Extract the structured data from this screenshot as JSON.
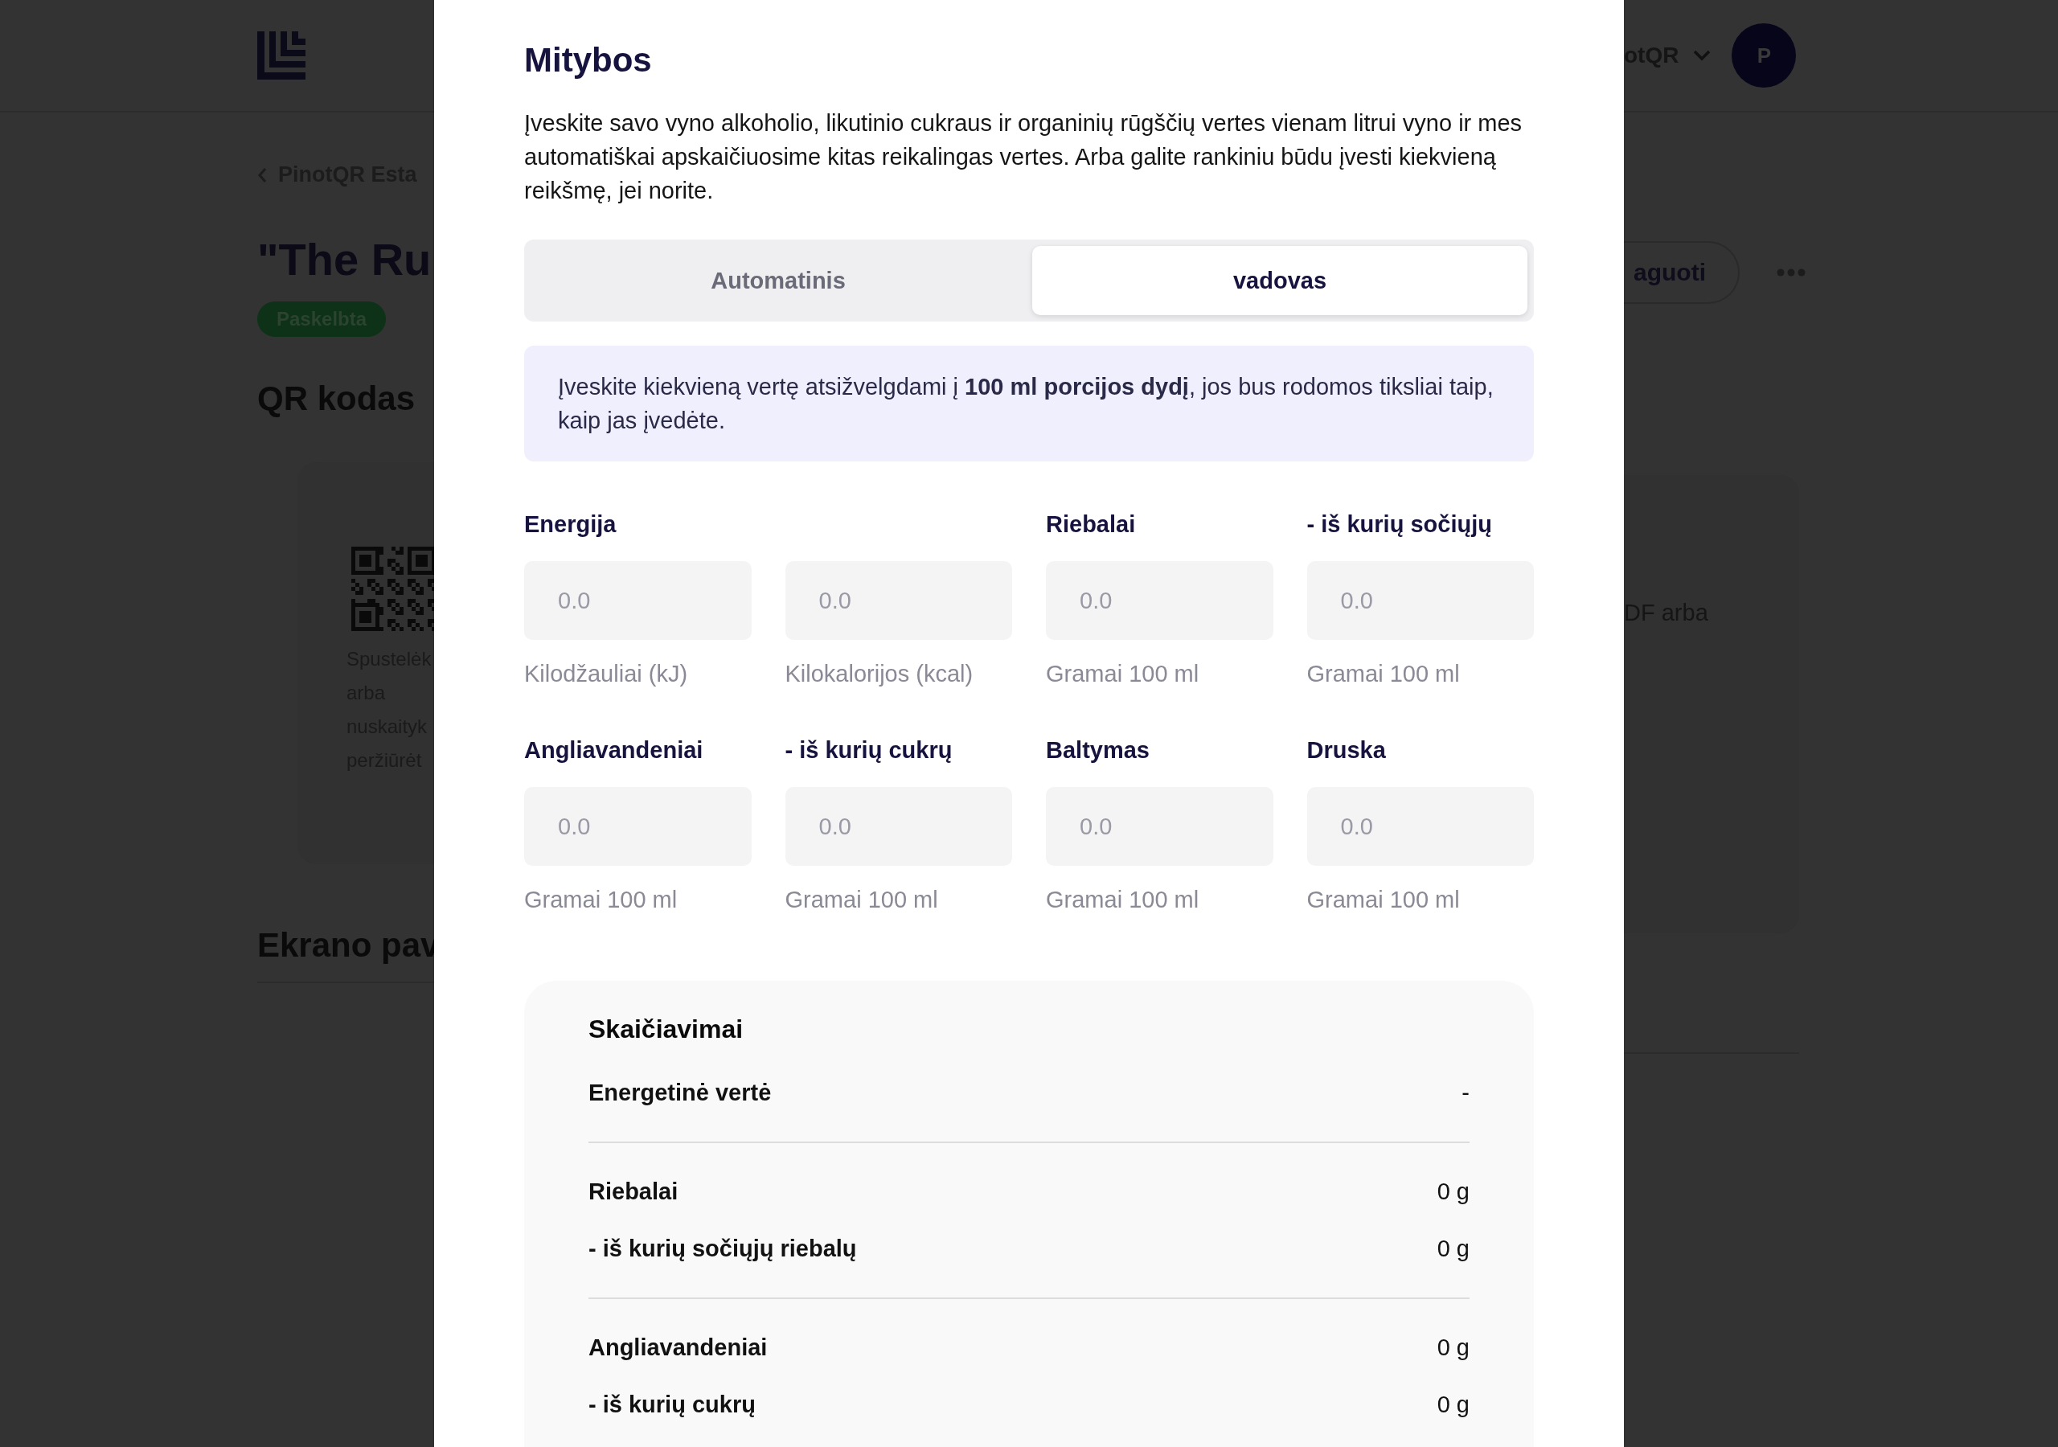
{
  "background_page": {
    "header": {
      "account_label": "otQR",
      "avatar_initial": "P"
    },
    "back_link": "PinotQR Esta",
    "title": "\"The Ru",
    "status_badge": "Paskelbta",
    "action_button": "aguoti",
    "qr_section": {
      "heading": "QR kodas",
      "caption_lines": [
        "Spustelėk",
        "arba",
        "nuskaityk",
        "peržiūrėt"
      ],
      "right_text": "DF arba"
    },
    "screenshots_heading": "Ekrano pav"
  },
  "modal": {
    "title": "Mitybos",
    "intro": "Įveskite savo vyno alkoholio, likutinio cukraus ir organinių rūgščių vertes vienam litrui vyno ir mes automatiškai apskaičiuosime kitas reikalingas vertes. Arba galite rankiniu būdu įvesti kiekvieną reikšmę, jei norite.",
    "tabs": [
      {
        "label": "Automatinis",
        "selected": false
      },
      {
        "label": "vadovas",
        "selected": true
      }
    ],
    "info": "Įveskite kiekvieną vertę atsižvelgdami į **100 ml porcijos dydį**, jos bus rodomos tiksliai taip, kaip jas įvedėte.",
    "fields": [
      {
        "label": "Energija",
        "placeholder": "0.0",
        "unit": "Kilodžauliai (kJ)"
      },
      {
        "placeholder": "0.0",
        "unit": "Kilokalorijos (kcal)"
      },
      {
        "label": "Riebalai",
        "placeholder": "0.0",
        "unit": "Gramai 100 ml"
      },
      {
        "label": "- iš kurių sočiųjų",
        "placeholder": "0.0",
        "unit": "Gramai 100 ml"
      },
      {
        "label": "Angliavandeniai",
        "placeholder": "0.0",
        "unit": "Gramai 100 ml"
      },
      {
        "label": "- iš kurių cukrų",
        "placeholder": "0.0",
        "unit": "Gramai 100 ml"
      },
      {
        "label": "Baltymas",
        "placeholder": "0.0",
        "unit": "Gramai 100 ml"
      },
      {
        "label": "Druska",
        "placeholder": "0.0",
        "unit": "Gramai 100 ml"
      }
    ],
    "calculations": {
      "title": "Skaičiavimai",
      "groups": [
        [
          {
            "label": "Energetinė vertė",
            "value": "-"
          }
        ],
        [
          {
            "label": "Riebalai",
            "value": "0 g"
          },
          {
            "label": "- iš kurių sočiųjų riebalų",
            "value": "0 g"
          }
        ],
        [
          {
            "label": "Angliavandeniai",
            "value": "0 g"
          },
          {
            "label": "- iš kurių cukrų",
            "value": "0 g"
          }
        ]
      ]
    }
  }
}
